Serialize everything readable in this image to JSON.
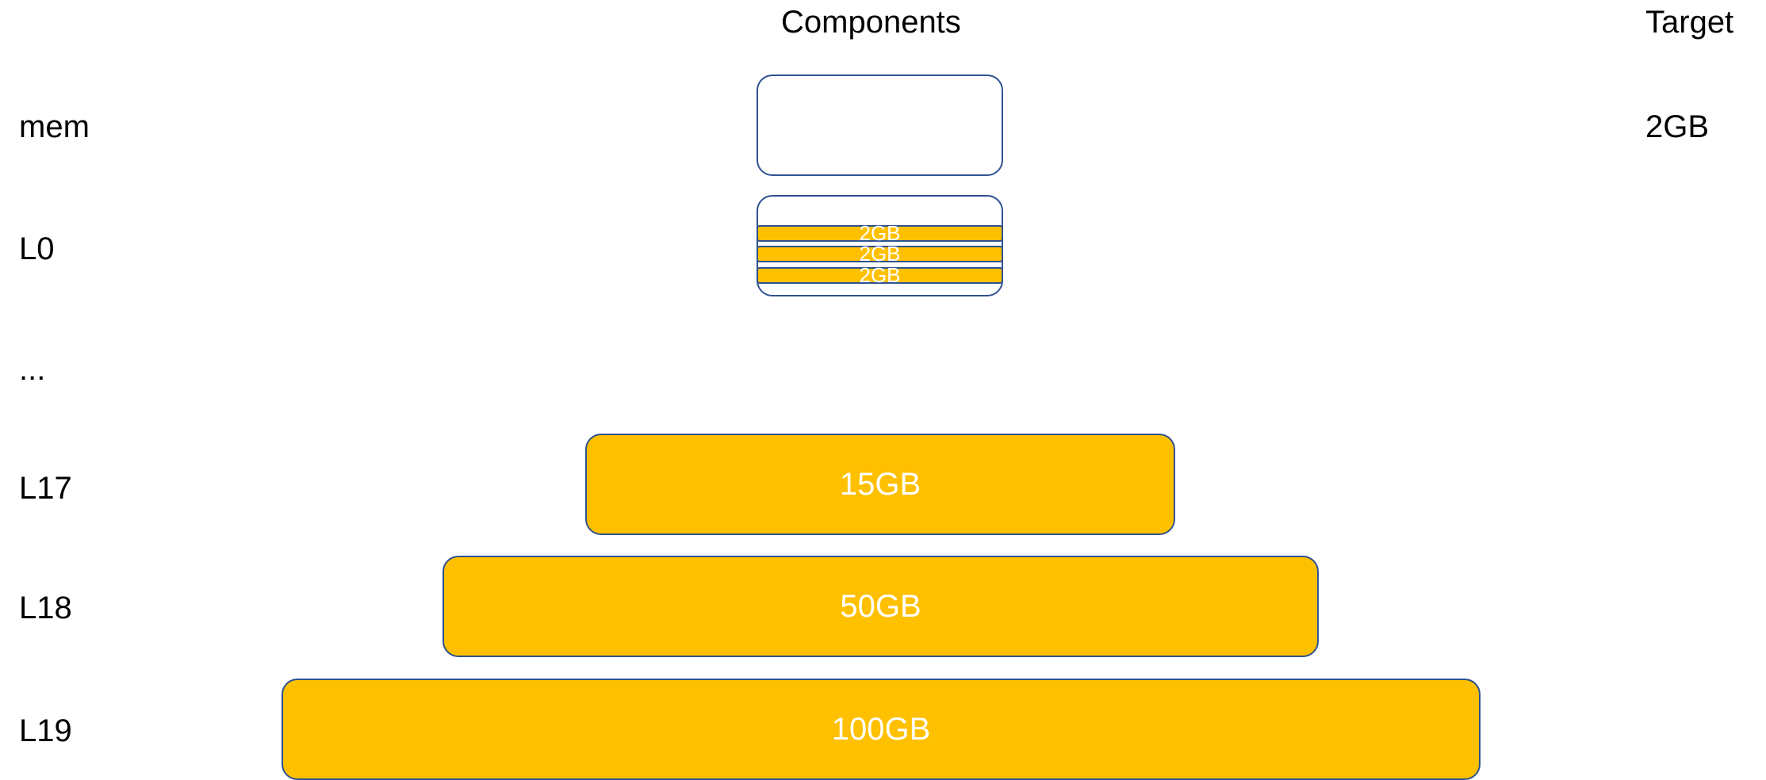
{
  "headers": {
    "components": "Components",
    "target": "Target"
  },
  "colors": {
    "fill": "#ffc000",
    "border": "#2f528f",
    "box_text": "#ffffff"
  },
  "rows": {
    "mem": {
      "label": "mem",
      "target": "2GB"
    },
    "l0": {
      "label": "L0",
      "files": [
        "2GB",
        "2GB",
        "2GB"
      ]
    },
    "ellipsis": {
      "label": "..."
    },
    "l17": {
      "label": "L17",
      "size": "15GB"
    },
    "l18": {
      "label": "L18",
      "size": "50GB"
    },
    "l19": {
      "label": "L19",
      "size": "100GB"
    }
  }
}
